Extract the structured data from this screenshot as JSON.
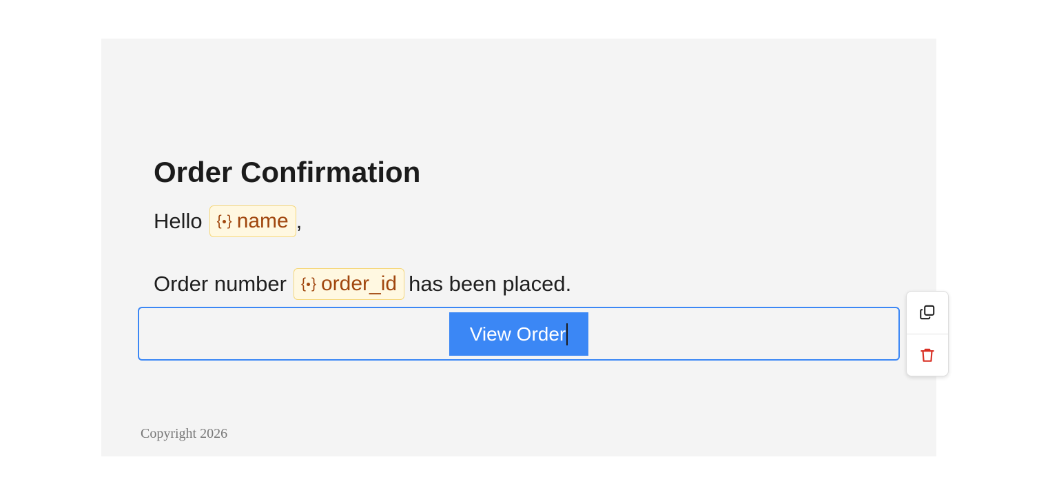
{
  "email": {
    "heading": "Order Confirmation",
    "greeting": {
      "prefix": "Hello",
      "variable": "name",
      "suffix": ","
    },
    "order_line": {
      "prefix": "Order number",
      "variable": "order_id",
      "suffix": "has been placed."
    },
    "button": {
      "label": "View Order"
    },
    "footer": "Copyright 2026"
  },
  "toolbar": {
    "actions": [
      {
        "name": "duplicate",
        "icon": "copy-icon"
      },
      {
        "name": "delete",
        "icon": "trash-icon"
      }
    ]
  },
  "colors": {
    "canvas_background": "#f4f4f4",
    "selection_border": "#3b87f5",
    "button_background": "#3b87f5",
    "variable_chip_background": "#fff8e1",
    "variable_chip_border": "#f5d77a",
    "variable_text": "#a0460e",
    "delete_icon": "#d93025"
  }
}
